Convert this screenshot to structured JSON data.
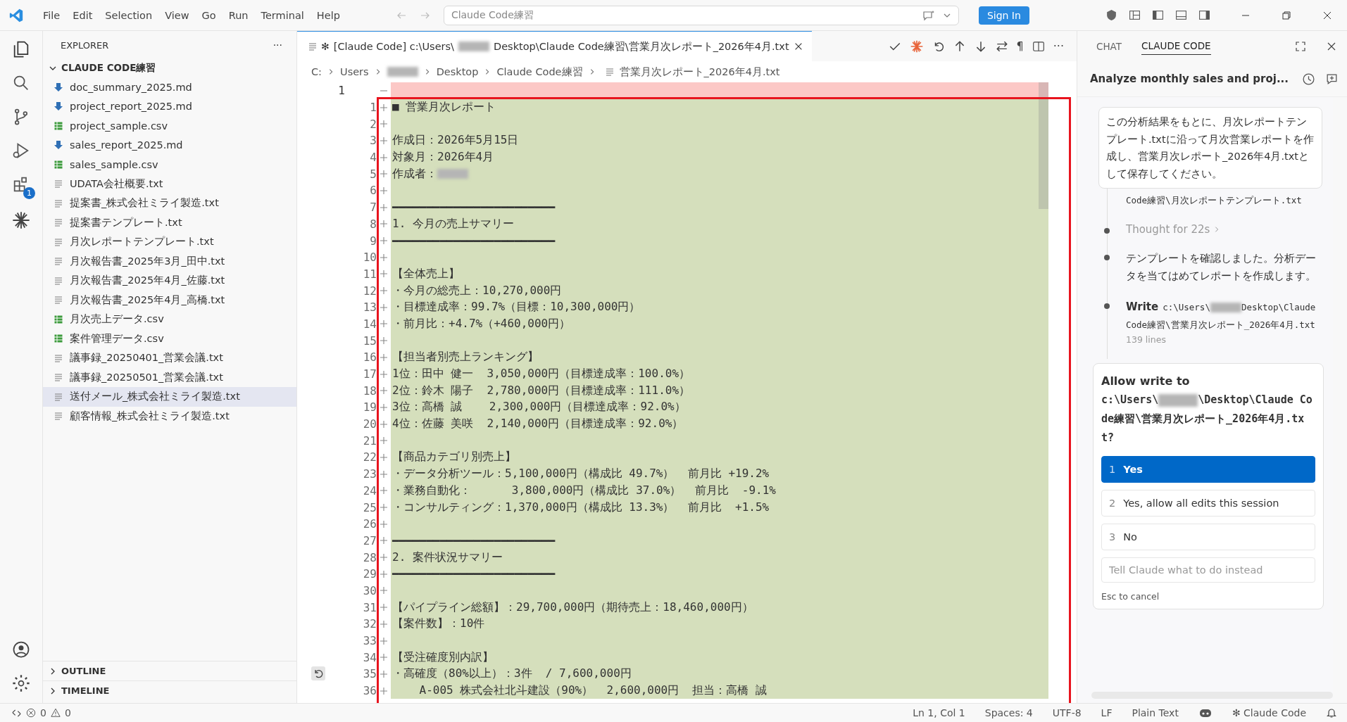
{
  "menu": [
    "File",
    "Edit",
    "Selection",
    "View",
    "Go",
    "Run",
    "Terminal",
    "Help"
  ],
  "command_center": {
    "value": "Claude Code練習"
  },
  "sign_in": "Sign In",
  "activity": {
    "badge": "1"
  },
  "explorer": {
    "title": "EXPLORER",
    "more": "···",
    "folder": {
      "label": "CLAUDE CODE練習",
      "expanded": true
    },
    "files": [
      {
        "name": "doc_summary_2025.md",
        "kind": "md",
        "selected": false
      },
      {
        "name": "project_report_2025.md",
        "kind": "md",
        "selected": false
      },
      {
        "name": "project_sample.csv",
        "kind": "csv",
        "selected": false
      },
      {
        "name": "sales_report_2025.md",
        "kind": "md",
        "selected": false
      },
      {
        "name": "sales_sample.csv",
        "kind": "csv",
        "selected": false
      },
      {
        "name": "UDATA会社概要.txt",
        "kind": "txt",
        "selected": false
      },
      {
        "name": "提案書_株式会社ミライ製造.txt",
        "kind": "txt",
        "selected": false
      },
      {
        "name": "提案書テンプレート.txt",
        "kind": "txt",
        "selected": false
      },
      {
        "name": "月次レポートテンプレート.txt",
        "kind": "txt",
        "selected": false
      },
      {
        "name": "月次報告書_2025年3月_田中.txt",
        "kind": "txt",
        "selected": false
      },
      {
        "name": "月次報告書_2025年4月_佐藤.txt",
        "kind": "txt",
        "selected": false
      },
      {
        "name": "月次報告書_2025年4月_高橋.txt",
        "kind": "txt",
        "selected": false
      },
      {
        "name": "月次売上データ.csv",
        "kind": "csv",
        "selected": false
      },
      {
        "name": "案件管理データ.csv",
        "kind": "csv",
        "selected": false
      },
      {
        "name": "議事録_20250401_営業会議.txt",
        "kind": "txt",
        "selected": false
      },
      {
        "name": "議事録_20250501_営業会議.txt",
        "kind": "txt",
        "selected": false
      },
      {
        "name": "送付メール_株式会社ミライ製造.txt",
        "kind": "txt",
        "selected": true
      },
      {
        "name": "顧客情報_株式会社ミライ製造.txt",
        "kind": "txt",
        "selected": false
      }
    ],
    "sections": [
      {
        "label": "OUTLINE",
        "expanded": false
      },
      {
        "label": "TIMELINE",
        "expanded": false
      }
    ]
  },
  "editor": {
    "tab": {
      "mark": "✻",
      "before": "[Claude Code] c:\\Users\\",
      "after": "Desktop\\Claude Code練習\\営業月次レポート_2026年4月.txt"
    },
    "toolbar_pilcrow": "¶",
    "toolbar_more": "···",
    "breadcrumbs": [
      {
        "kind": "text",
        "label": "C:"
      },
      {
        "kind": "text",
        "label": "Users"
      },
      {
        "kind": "redacted"
      },
      {
        "kind": "text",
        "label": "Desktop"
      },
      {
        "kind": "text",
        "label": "Claude Code練習"
      },
      {
        "kind": "file",
        "label": "営業月次レポート_2026年4月.txt"
      }
    ],
    "lines": [
      {
        "kind": "removed",
        "number": "1"
      },
      {
        "kind": "added",
        "number": "1",
        "text": "■ 営業月次レポート"
      },
      {
        "kind": "added",
        "number": "2"
      },
      {
        "kind": "added",
        "number": "3",
        "text": "作成日：2026年5月15日"
      },
      {
        "kind": "added",
        "number": "4",
        "text": "対象月：2026年4月"
      },
      {
        "kind": "added",
        "number": "5",
        "text": "作成者：",
        "redacted": true
      },
      {
        "kind": "added",
        "number": "6"
      },
      {
        "kind": "added",
        "number": "7",
        "text": "━━━━━━━━━━━━━━━━━━━━━━━━"
      },
      {
        "kind": "added",
        "number": "8",
        "text": "1. 今月の売上サマリー"
      },
      {
        "kind": "added",
        "number": "9",
        "text": "━━━━━━━━━━━━━━━━━━━━━━━━"
      },
      {
        "kind": "added",
        "number": "10"
      },
      {
        "kind": "added",
        "number": "11",
        "text": "【全体売上】"
      },
      {
        "kind": "added",
        "number": "12",
        "text": "・今月の総売上：10,270,000円"
      },
      {
        "kind": "added",
        "number": "13",
        "text": "・目標達成率：99.7%（目標：10,300,000円）"
      },
      {
        "kind": "added",
        "number": "14",
        "text": "・前月比：+4.7%（+460,000円）"
      },
      {
        "kind": "added",
        "number": "15"
      },
      {
        "kind": "added",
        "number": "16",
        "text": "【担当者別売上ランキング】"
      },
      {
        "kind": "added",
        "number": "17",
        "text": "1位：田中 健一  3,050,000円（目標達成率：100.0%）"
      },
      {
        "kind": "added",
        "number": "18",
        "text": "2位：鈴木 陽子  2,780,000円（目標達成率：111.0%）"
      },
      {
        "kind": "added",
        "number": "19",
        "text": "3位：高橋 誠    2,300,000円（目標達成率：92.0%）"
      },
      {
        "kind": "added",
        "number": "20",
        "text": "4位：佐藤 美咲  2,140,000円（目標達成率：92.0%）"
      },
      {
        "kind": "added",
        "number": "21"
      },
      {
        "kind": "added",
        "number": "22",
        "text": "【商品カテゴリ別売上】"
      },
      {
        "kind": "added",
        "number": "23",
        "text": "・データ分析ツール：5,100,000円（構成比 49.7%）  前月比 +19.2%"
      },
      {
        "kind": "added",
        "number": "24",
        "text": "・業務自動化：      3,800,000円（構成比 37.0%）  前月比  -9.1%"
      },
      {
        "kind": "added",
        "number": "25",
        "text": "・コンサルティング：1,370,000円（構成比 13.3%）  前月比  +1.5%"
      },
      {
        "kind": "added",
        "number": "26"
      },
      {
        "kind": "added",
        "number": "27",
        "text": "━━━━━━━━━━━━━━━━━━━━━━━━"
      },
      {
        "kind": "added",
        "number": "28",
        "text": "2. 案件状況サマリー"
      },
      {
        "kind": "added",
        "number": "29",
        "text": "━━━━━━━━━━━━━━━━━━━━━━━━"
      },
      {
        "kind": "added",
        "number": "30"
      },
      {
        "kind": "added",
        "number": "31",
        "text": "【パイプライン総額】：29,700,000円（期待売上：18,460,000円）"
      },
      {
        "kind": "added",
        "number": "32",
        "text": "【案件数】：10件"
      },
      {
        "kind": "added",
        "number": "33"
      },
      {
        "kind": "added",
        "number": "34",
        "text": "【受注確度別内訳】"
      },
      {
        "kind": "added",
        "number": "35",
        "text": "・高確度（80%以上）：3件  / 7,600,000円"
      },
      {
        "kind": "added",
        "number": "36",
        "text": "    A-005 株式会社北斗建設（90%）  2,600,000円  担当：高橋 誠"
      }
    ]
  },
  "claude_panel": {
    "tabs": [
      {
        "label": "CHAT",
        "selected": false
      },
      {
        "label": "CLAUDE CODE",
        "selected": true
      }
    ],
    "session_title": "Analyze monthly sales and proj...",
    "user_message": "この分析結果をもとに、月次レポートテンプレート.txtに沿って月次営業レポートを作成し、営業月次レポート_2026年4月.txtとして保存してください。",
    "timeline": [
      {
        "kind": "path",
        "text": "Code練習\\月次レポートテンプレート.txt"
      },
      {
        "kind": "thought",
        "text": "Thought for 22s"
      },
      {
        "kind": "message",
        "text": "テンプレートを確認しました。分析データを当てはめてレポートを作成します。"
      },
      {
        "kind": "tool",
        "label": "Write",
        "path_before": "c:\\Users\\",
        "path_after": "Desktop\\Claude Code練習\\営業月次レポート_2026年4月.txt",
        "meta": "139 lines"
      }
    ],
    "permission": {
      "title": "Allow write to",
      "path_before": "c:\\Users\\",
      "path_after": "\\Desktop\\Claude Code練習\\営業月次レポート_2026年4月.txt?",
      "options": [
        {
          "number": "1",
          "label": "Yes",
          "selected": true
        },
        {
          "number": "2",
          "label": "Yes, allow all edits this session",
          "selected": false
        },
        {
          "number": "3",
          "label": "No",
          "selected": false
        }
      ],
      "input": {
        "placeholder": "Tell Claude what to do instead"
      },
      "hint": "Esc to cancel"
    }
  },
  "status_bar": {
    "errors": "0",
    "warnings": "0",
    "right": [
      "Ln 1, Col 1",
      "Spaces: 4",
      "UTF-8",
      "LF",
      "Plain Text"
    ],
    "claude": "✻ Claude Code"
  }
}
